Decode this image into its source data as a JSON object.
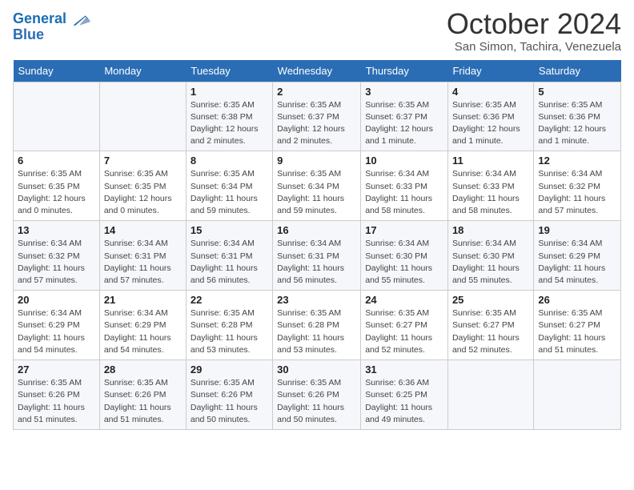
{
  "header": {
    "logo_line1": "General",
    "logo_line2": "Blue",
    "month": "October 2024",
    "location": "San Simon, Tachira, Venezuela"
  },
  "weekdays": [
    "Sunday",
    "Monday",
    "Tuesday",
    "Wednesday",
    "Thursday",
    "Friday",
    "Saturday"
  ],
  "weeks": [
    [
      {
        "day": "",
        "info": ""
      },
      {
        "day": "",
        "info": ""
      },
      {
        "day": "1",
        "info": "Sunrise: 6:35 AM\nSunset: 6:38 PM\nDaylight: 12 hours and 2 minutes."
      },
      {
        "day": "2",
        "info": "Sunrise: 6:35 AM\nSunset: 6:37 PM\nDaylight: 12 hours and 2 minutes."
      },
      {
        "day": "3",
        "info": "Sunrise: 6:35 AM\nSunset: 6:37 PM\nDaylight: 12 hours and 1 minute."
      },
      {
        "day": "4",
        "info": "Sunrise: 6:35 AM\nSunset: 6:36 PM\nDaylight: 12 hours and 1 minute."
      },
      {
        "day": "5",
        "info": "Sunrise: 6:35 AM\nSunset: 6:36 PM\nDaylight: 12 hours and 1 minute."
      }
    ],
    [
      {
        "day": "6",
        "info": "Sunrise: 6:35 AM\nSunset: 6:35 PM\nDaylight: 12 hours and 0 minutes."
      },
      {
        "day": "7",
        "info": "Sunrise: 6:35 AM\nSunset: 6:35 PM\nDaylight: 12 hours and 0 minutes."
      },
      {
        "day": "8",
        "info": "Sunrise: 6:35 AM\nSunset: 6:34 PM\nDaylight: 11 hours and 59 minutes."
      },
      {
        "day": "9",
        "info": "Sunrise: 6:35 AM\nSunset: 6:34 PM\nDaylight: 11 hours and 59 minutes."
      },
      {
        "day": "10",
        "info": "Sunrise: 6:34 AM\nSunset: 6:33 PM\nDaylight: 11 hours and 58 minutes."
      },
      {
        "day": "11",
        "info": "Sunrise: 6:34 AM\nSunset: 6:33 PM\nDaylight: 11 hours and 58 minutes."
      },
      {
        "day": "12",
        "info": "Sunrise: 6:34 AM\nSunset: 6:32 PM\nDaylight: 11 hours and 57 minutes."
      }
    ],
    [
      {
        "day": "13",
        "info": "Sunrise: 6:34 AM\nSunset: 6:32 PM\nDaylight: 11 hours and 57 minutes."
      },
      {
        "day": "14",
        "info": "Sunrise: 6:34 AM\nSunset: 6:31 PM\nDaylight: 11 hours and 57 minutes."
      },
      {
        "day": "15",
        "info": "Sunrise: 6:34 AM\nSunset: 6:31 PM\nDaylight: 11 hours and 56 minutes."
      },
      {
        "day": "16",
        "info": "Sunrise: 6:34 AM\nSunset: 6:31 PM\nDaylight: 11 hours and 56 minutes."
      },
      {
        "day": "17",
        "info": "Sunrise: 6:34 AM\nSunset: 6:30 PM\nDaylight: 11 hours and 55 minutes."
      },
      {
        "day": "18",
        "info": "Sunrise: 6:34 AM\nSunset: 6:30 PM\nDaylight: 11 hours and 55 minutes."
      },
      {
        "day": "19",
        "info": "Sunrise: 6:34 AM\nSunset: 6:29 PM\nDaylight: 11 hours and 54 minutes."
      }
    ],
    [
      {
        "day": "20",
        "info": "Sunrise: 6:34 AM\nSunset: 6:29 PM\nDaylight: 11 hours and 54 minutes."
      },
      {
        "day": "21",
        "info": "Sunrise: 6:34 AM\nSunset: 6:29 PM\nDaylight: 11 hours and 54 minutes."
      },
      {
        "day": "22",
        "info": "Sunrise: 6:35 AM\nSunset: 6:28 PM\nDaylight: 11 hours and 53 minutes."
      },
      {
        "day": "23",
        "info": "Sunrise: 6:35 AM\nSunset: 6:28 PM\nDaylight: 11 hours and 53 minutes."
      },
      {
        "day": "24",
        "info": "Sunrise: 6:35 AM\nSunset: 6:27 PM\nDaylight: 11 hours and 52 minutes."
      },
      {
        "day": "25",
        "info": "Sunrise: 6:35 AM\nSunset: 6:27 PM\nDaylight: 11 hours and 52 minutes."
      },
      {
        "day": "26",
        "info": "Sunrise: 6:35 AM\nSunset: 6:27 PM\nDaylight: 11 hours and 51 minutes."
      }
    ],
    [
      {
        "day": "27",
        "info": "Sunrise: 6:35 AM\nSunset: 6:26 PM\nDaylight: 11 hours and 51 minutes."
      },
      {
        "day": "28",
        "info": "Sunrise: 6:35 AM\nSunset: 6:26 PM\nDaylight: 11 hours and 51 minutes."
      },
      {
        "day": "29",
        "info": "Sunrise: 6:35 AM\nSunset: 6:26 PM\nDaylight: 11 hours and 50 minutes."
      },
      {
        "day": "30",
        "info": "Sunrise: 6:35 AM\nSunset: 6:26 PM\nDaylight: 11 hours and 50 minutes."
      },
      {
        "day": "31",
        "info": "Sunrise: 6:36 AM\nSunset: 6:25 PM\nDaylight: 11 hours and 49 minutes."
      },
      {
        "day": "",
        "info": ""
      },
      {
        "day": "",
        "info": ""
      }
    ]
  ]
}
